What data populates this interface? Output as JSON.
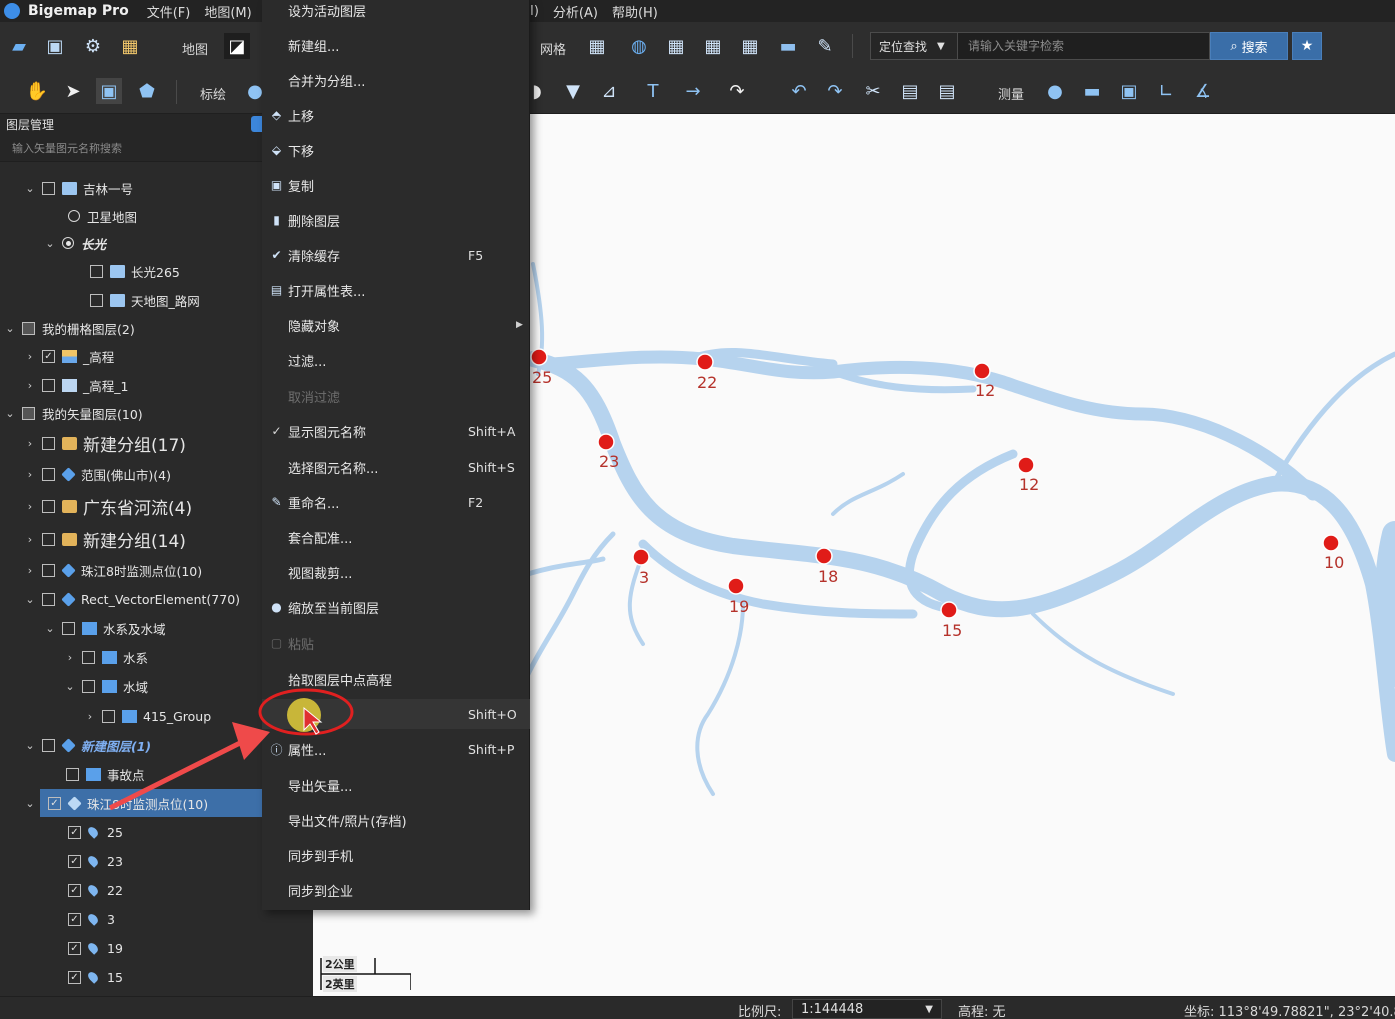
{
  "app": {
    "name": "Bigemap Pro"
  },
  "menubar": {
    "left": [
      "文件(F)",
      "地图(M)"
    ],
    "right": [
      "I)",
      "分析(A)",
      "帮助(H)"
    ]
  },
  "toolbar1": {
    "map_label": "地图",
    "grid_label": "网格",
    "locate_label": "定位查找",
    "search_placeholder": "请输入关键字检索",
    "search_button": "搜索"
  },
  "toolbar2": {
    "annotate_label": "标绘",
    "measure_label": "测量"
  },
  "layer_panel": {
    "title": "图层管理",
    "search_placeholder": "输入矢量图元名称搜索",
    "rows": [
      {
        "label": "吉林一号"
      },
      {
        "label": "卫星地图"
      },
      {
        "label": "长光"
      },
      {
        "label": "长光265"
      },
      {
        "label": "天地图_路网"
      },
      {
        "label": "我的栅格图层(2)"
      },
      {
        "label": "_高程"
      },
      {
        "label": "_高程_1"
      },
      {
        "label": "我的矢量图层(10)"
      },
      {
        "label": "新建分组(17)"
      },
      {
        "label": "范围(佛山市)(4)"
      },
      {
        "label": "广东省河流(4)"
      },
      {
        "label": "新建分组(14)"
      },
      {
        "label": "珠江8时监测点位(10)"
      },
      {
        "label": "Rect_VectorElement(770)"
      },
      {
        "label": "水系及水域"
      },
      {
        "label": "水系"
      },
      {
        "label": "水域"
      },
      {
        "label": "415_Group"
      },
      {
        "label": "新建图层(1)"
      },
      {
        "label": "事故点"
      },
      {
        "label": "珠江8时监测点位(10)"
      },
      {
        "label": "25"
      },
      {
        "label": "23"
      },
      {
        "label": "22"
      },
      {
        "label": "3"
      },
      {
        "label": "19"
      },
      {
        "label": "15"
      }
    ]
  },
  "context_menu": {
    "items": [
      {
        "label": "设为活动图层"
      },
      {
        "label": "新建组..."
      },
      {
        "label": "合并为分组..."
      },
      {
        "label": "上移"
      },
      {
        "label": "下移"
      },
      {
        "label": "复制"
      },
      {
        "label": "删除图层"
      },
      {
        "label": "清除缓存",
        "shortcut": "F5"
      },
      {
        "label": "打开属性表..."
      },
      {
        "label": "隐藏对象"
      },
      {
        "label": "过滤..."
      },
      {
        "label": "取消过滤"
      },
      {
        "label": "显示图元名称",
        "shortcut": "Shift+A"
      },
      {
        "label": "选择图元名称...",
        "shortcut": "Shift+S"
      },
      {
        "label": "重命名...",
        "shortcut": "F2"
      },
      {
        "label": "套合配准..."
      },
      {
        "label": "视图裁剪..."
      },
      {
        "label": "缩放至当前图层"
      },
      {
        "label": "粘贴"
      },
      {
        "label": "拾取图层中点高程"
      },
      {
        "label": "",
        "shortcut": "Shift+O"
      },
      {
        "label": "属性...",
        "shortcut": "Shift+P"
      },
      {
        "label": "导出矢量..."
      },
      {
        "label": "导出文件/照片(存档)"
      },
      {
        "label": "同步到手机"
      },
      {
        "label": "同步到企业"
      }
    ]
  },
  "map": {
    "river_color": "#b6d3ee",
    "marker_color": "#e01c18",
    "markers": [
      {
        "label": "25"
      },
      {
        "label": "22"
      },
      {
        "label": "12"
      },
      {
        "label": "23"
      },
      {
        "label": "12"
      },
      {
        "label": "3"
      },
      {
        "label": "18"
      },
      {
        "label": "19"
      },
      {
        "label": "15"
      },
      {
        "label": "10"
      }
    ],
    "scale_km": "2公里",
    "scale_mi": "2英里"
  },
  "statusbar": {
    "scale_label": "比例尺:",
    "scale_value": "1:144448",
    "elevation": "高程: 无",
    "coords": "坐标: 113°8'49.78821\", 23°2'40.8"
  }
}
